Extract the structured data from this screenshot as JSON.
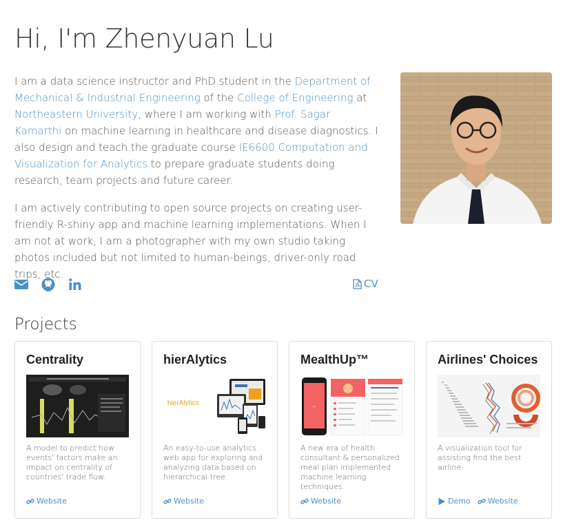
{
  "header": {
    "title": "Hi, I'm Zhenyuan Lu"
  },
  "bio": {
    "p1": {
      "t1": "I am a data science instructor and PhD student in the ",
      "l1": "Department of Mechanical & Industrial Engineering",
      "t2": " of the ",
      "l2": "College of Engineering",
      "t3": " at ",
      "l3": "Northeastern University",
      "t4": ", where I am working with ",
      "l4": "Prof. Sagar Kamarthi",
      "t5": " on machine learning in healthcare and disease diagnostics. I also design and teach the graduate course ",
      "l5": "IE6600 Computation and Visualization for Analytics",
      "t6": " to prepare graduate students doing research, team projects and future career."
    },
    "p2": "I am actively contributing to open source projects on creating user-friendly R-shiny app and machine learning implementations. When I am not at work, I am a photographer with my own studio taking photos included but not limited to human-beings, driver-only road trips, etc."
  },
  "social": {
    "icons": [
      "envelope-icon",
      "github-icon",
      "linkedin-icon"
    ],
    "cv_label": "CV"
  },
  "projects": {
    "title": "Projects",
    "items": [
      {
        "title": "Centrality",
        "desc": "A model to predict how events' factors make an impact on centrality of countries' trade flow.",
        "links": [
          "Website"
        ]
      },
      {
        "title": "hierAlytics",
        "desc": "An easy-to-use analytics web app for exploring and analyzing data based on hierarchical tree.",
        "links": [
          "Website"
        ],
        "thumb_text": "hierAlytics"
      },
      {
        "title": "MealthUp™",
        "desc": "A new era of health consultant & personalized meal plan implemented machine learning techniques.",
        "links": [
          "Website"
        ]
      },
      {
        "title": "Airlines' Choices",
        "desc": "A visualization tool for assisting find the best airline.",
        "links": [
          "Demo",
          "Website"
        ]
      }
    ]
  },
  "colors": {
    "link": "#4a90c9",
    "text": "#555555",
    "border": "#dddddd"
  }
}
